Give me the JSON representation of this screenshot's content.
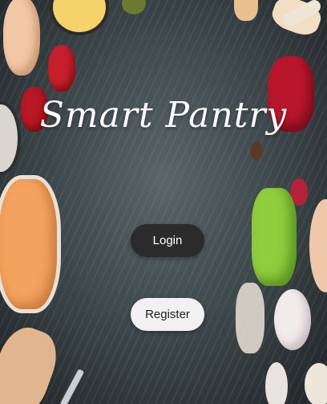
{
  "app": {
    "title": "Smart Pantry"
  },
  "buttons": {
    "login_label": "Login",
    "register_label": "Register"
  },
  "colors": {
    "background": "#3f4a4d",
    "login_button": "#2b2b2b",
    "register_button": "#f1f1f1",
    "title_text": "#ffffff"
  }
}
